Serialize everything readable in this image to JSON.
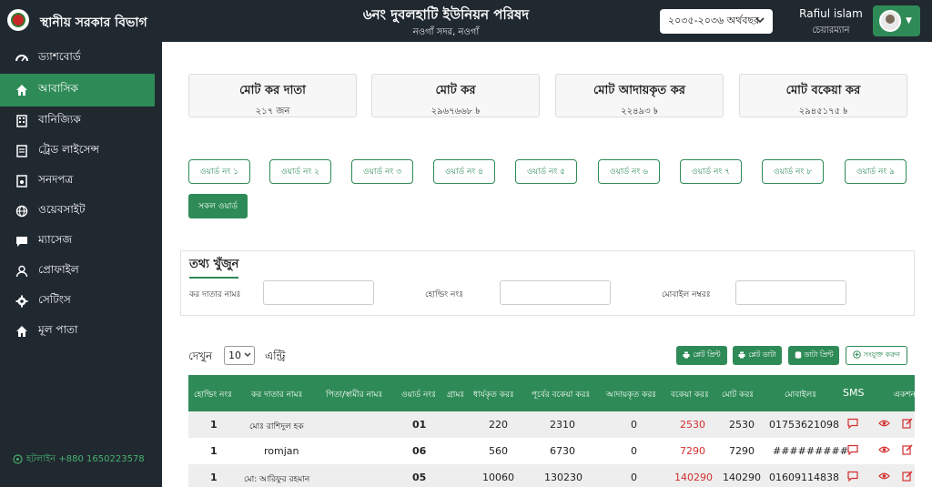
{
  "header": {
    "brand": "স্থানীয় সরকার বিভাগ",
    "union_title": "৬নং দুবলহাটি ইউনিয়ন পরিষদ",
    "union_subtitle": "নওগাঁ সদর, নওগাঁ",
    "fiscal_year": "২০৩৫-২০৩৬ অর্থবছর",
    "user_name": "Rafiul islam",
    "user_role": "চেয়ারম্যান"
  },
  "sidebar": {
    "items": [
      {
        "label": "ড্যাশবোর্ড",
        "icon": "dashboard-icon"
      },
      {
        "label": "আবাসিক",
        "icon": "home-icon"
      },
      {
        "label": "বানিজ্যিক",
        "icon": "building-icon"
      },
      {
        "label": "ট্রেড লাইসেন্স",
        "icon": "license-icon"
      },
      {
        "label": "সনদপত্র",
        "icon": "certificate-icon"
      },
      {
        "label": "ওয়েবসাইট",
        "icon": "globe-icon"
      },
      {
        "label": "ম্যাসেজ",
        "icon": "message-icon"
      },
      {
        "label": "প্রোফাইল",
        "icon": "user-icon"
      },
      {
        "label": "সেটিংস",
        "icon": "gear-icon"
      },
      {
        "label": "মূল পাতা",
        "icon": "home-icon"
      }
    ],
    "active_index": 1,
    "hotline": "হটলাইন +880 1650223578"
  },
  "stats": [
    {
      "label": "মোট কর দাতা",
      "value": "২১৭ জন"
    },
    {
      "label": "মোট কর",
      "value": "২৯৬৭৬৬৮ ৳"
    },
    {
      "label": "মোট আদায়কৃত কর",
      "value": "২২৪৯৩ ৳"
    },
    {
      "label": "মোট বকেয়া কর",
      "value": "২৯৪৫১৭৫ ৳"
    }
  ],
  "wards": [
    "ওয়ার্ড নং ১",
    "ওয়ার্ড নং ২",
    "ওয়ার্ড নং ৩",
    "ওয়ার্ড নং ৪",
    "ওয়ার্ড নং ৫",
    "ওয়ার্ড নং ৬",
    "ওয়ার্ড নং ৭",
    "ওয়ার্ড নং ৮",
    "ওয়ার্ড নং ৯"
  ],
  "ward_all": "সকল ওয়ার্ড",
  "search": {
    "title": "তথ্য খুঁজুন",
    "taxpayer_label": "কর দাতার নামঃ",
    "holding_label": "হোল্ডিং নংঃ",
    "mobile_label": "মোবাইল নম্বরঃ"
  },
  "table_controls": {
    "show_label": "দেখুন",
    "page_size": "10",
    "entries_label": "এন্ট্রি",
    "buttons": [
      "প্লেট প্রিন্ট",
      "প্লেট ডাটা",
      "ডাটা প্রিন্ট",
      "সংযুক্ত করুন"
    ]
  },
  "table": {
    "headers": [
      "হোল্ডিং নংঃ",
      "কর দাতার নামঃ",
      "পিতা/স্বামীর নামঃ",
      "ওয়ার্ড নংঃ",
      "গ্রামঃ",
      "ধার্যকৃত করঃ",
      "পূর্বের বকেয়া করঃ",
      "আদায়কৃত করঃ",
      "বকেয়া করঃ",
      "মোট করঃ",
      "মোবাইলঃ",
      "SMS",
      "একশন"
    ],
    "rows": [
      {
        "holding": "1",
        "name": "মোঃ রাশিদুল হক",
        "ward": "01",
        "assessed": "220",
        "prev_due": "2310",
        "collected": "0",
        "due": "2530",
        "total": "2530",
        "mobile": "01753621098"
      },
      {
        "holding": "1",
        "name": "romjan",
        "ward": "06",
        "assessed": "560",
        "prev_due": "6730",
        "collected": "0",
        "due": "7290",
        "total": "7290",
        "mobile": "#########"
      },
      {
        "holding": "1",
        "name": "মো: আরিফুর রহমান",
        "ward": "05",
        "assessed": "10060",
        "prev_due": "130230",
        "collected": "0",
        "due": "140290",
        "total": "140290",
        "mobile": "01609114838"
      }
    ]
  },
  "colors": {
    "accent": "#2e8b57",
    "sidebar": "#202830",
    "due": "#d32f2f"
  }
}
